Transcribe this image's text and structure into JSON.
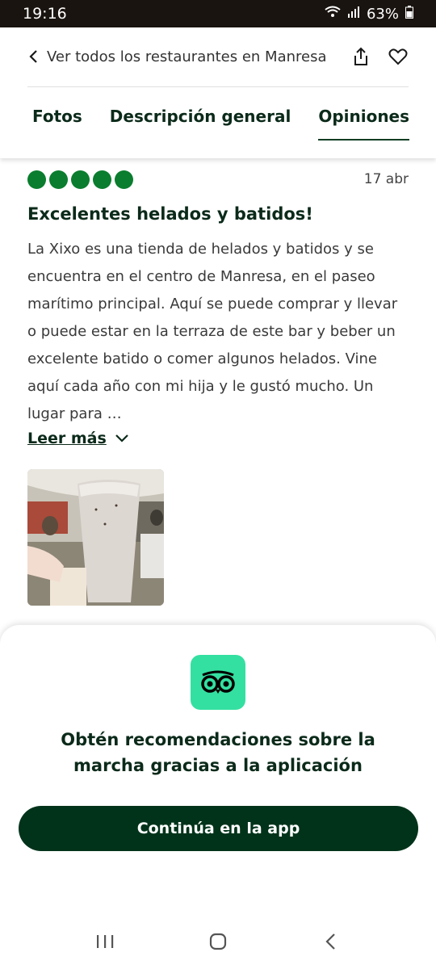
{
  "status": {
    "time": "19:16",
    "battery": "63%"
  },
  "nav": {
    "back_label": "Ver todos los restaurantes en Manresa",
    "tabs": [
      {
        "label": "Fotos",
        "active": false
      },
      {
        "label": "Descripción general",
        "active": false
      },
      {
        "label": "Opiniones",
        "active": true
      }
    ]
  },
  "review": {
    "rating": 5,
    "date": "17 abr",
    "title": "Excelentes helados y batidos!",
    "body": "La Xixo es una tienda de helados y batidos y se encuentra en el centro de Manresa, en el paseo marítimo principal. Aquí se puede comprar y llevar o puede estar en la terraza de este bar y beber un excelente batido o comer algunos helados. Vine aquí cada año con mi hija y le gustó mucho. Un lugar para …",
    "read_more": "Leer más"
  },
  "promo": {
    "text": "Obtén recomendaciones sobre la marcha gracias a la aplicación",
    "cta": "Continúa en la app"
  },
  "colors": {
    "brand_green": "#00331a",
    "bubble_green": "#0a7d2e",
    "logo_green": "#34e0a1"
  },
  "icons": [
    "wifi-icon",
    "signal-icon",
    "battery-icon",
    "chevron-left-icon",
    "share-icon",
    "heart-icon",
    "chevron-down-icon",
    "owl-logo-icon",
    "recents-icon",
    "home-icon",
    "back-icon"
  ]
}
